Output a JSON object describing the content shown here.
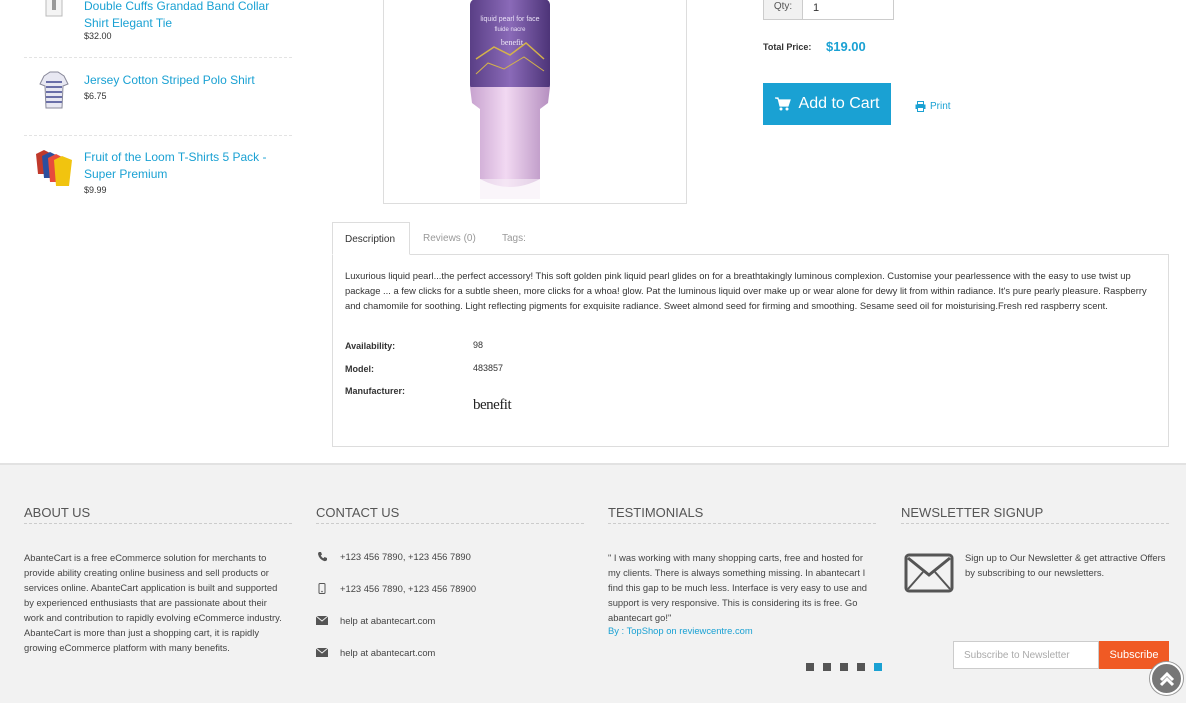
{
  "sidebar": {
    "products": [
      {
        "name": "Double Cuffs Grandad Band Collar Shirt Elegant Tie",
        "price": "$32.00",
        "thumb": "white-shirt-thumb"
      },
      {
        "name": "Jersey Cotton Striped Polo Shirt",
        "price": "$6.75",
        "thumb": "striped-polo-thumb"
      },
      {
        "name": "Fruit of the Loom T-Shirts 5 Pack - Super Premium",
        "price": "$9.99",
        "thumb": "tshirts-pack-thumb"
      }
    ]
  },
  "product": {
    "image": "pearl-bottle-image",
    "qty_label": "Qty:",
    "qty_value": "1",
    "total_label": "Total Price:",
    "total_value": "$19.00",
    "add_to_cart": "Add to Cart",
    "print": "Print"
  },
  "tabs": [
    {
      "label": "Description",
      "active": true
    },
    {
      "label": "Reviews (0)",
      "active": false
    },
    {
      "label": "Tags:",
      "active": false
    }
  ],
  "description": {
    "text": "Luxurious liquid pearl...the perfect accessory! This soft golden pink liquid pearl glides on for a breathtakingly luminous complexion. Customise your pearlessence with the easy to use twist up package ... a few clicks for a subtle sheen, more clicks for a whoa! glow. Pat the luminous liquid over make up or wear alone for dewy lit from within radiance. It's pure pearly pleasure. Raspberry and chamomile for soothing. Light reflecting pigments for exquisite radiance. Sweet almond seed for firming and smoothing. Sesame seed oil for moisturising.Fresh red raspberry scent.",
    "availability_label": "Availability:",
    "availability_value": "98",
    "model_label": "Model:",
    "model_value": "483857",
    "manufacturer_label": "Manufacturer:",
    "manufacturer_logo": "benefit"
  },
  "footer": {
    "about": {
      "title": "About Us",
      "text": "AbanteCart is a free eCommerce solution for merchants to provide ability creating online business and sell products or services online. AbanteCart application is built and supported by experienced enthusiasts that are passionate about their work and contribution to rapidly evolving eCommerce industry. AbanteCart is more than just a shopping cart, it is rapidly growing eCommerce platform with many benefits."
    },
    "contact": {
      "title": "Contact Us",
      "phone": "+123 456 7890, +123 456 7890",
      "mobile": "+123 456 7890, +123 456 78900",
      "email1": "help at abantecart.com",
      "email2": "help at abantecart.com"
    },
    "testimonials": {
      "title": "Testimonials",
      "quote": "\" I was working with many shopping carts, free and hosted for my clients. There is always something missing. In abantecart I find this gap to be much less. Interface is very easy to use and support is very responsive. This is considering its is free. Go abantecart go!\"",
      "by": "By : TopShop on reviewcentre.com",
      "dots": 5,
      "active_dot": 5
    },
    "newsletter": {
      "title": "Newsletter Signup",
      "text": "Sign up to Our Newsletter & get attractive Offers by subscribing to our newsletters.",
      "placeholder": "Subscribe to Newsletter",
      "button": "Subscribe"
    }
  },
  "colors": {
    "accent": "#1aa1d3",
    "subscribe": "#f05a24",
    "footer_bg": "#f2f2f2"
  }
}
